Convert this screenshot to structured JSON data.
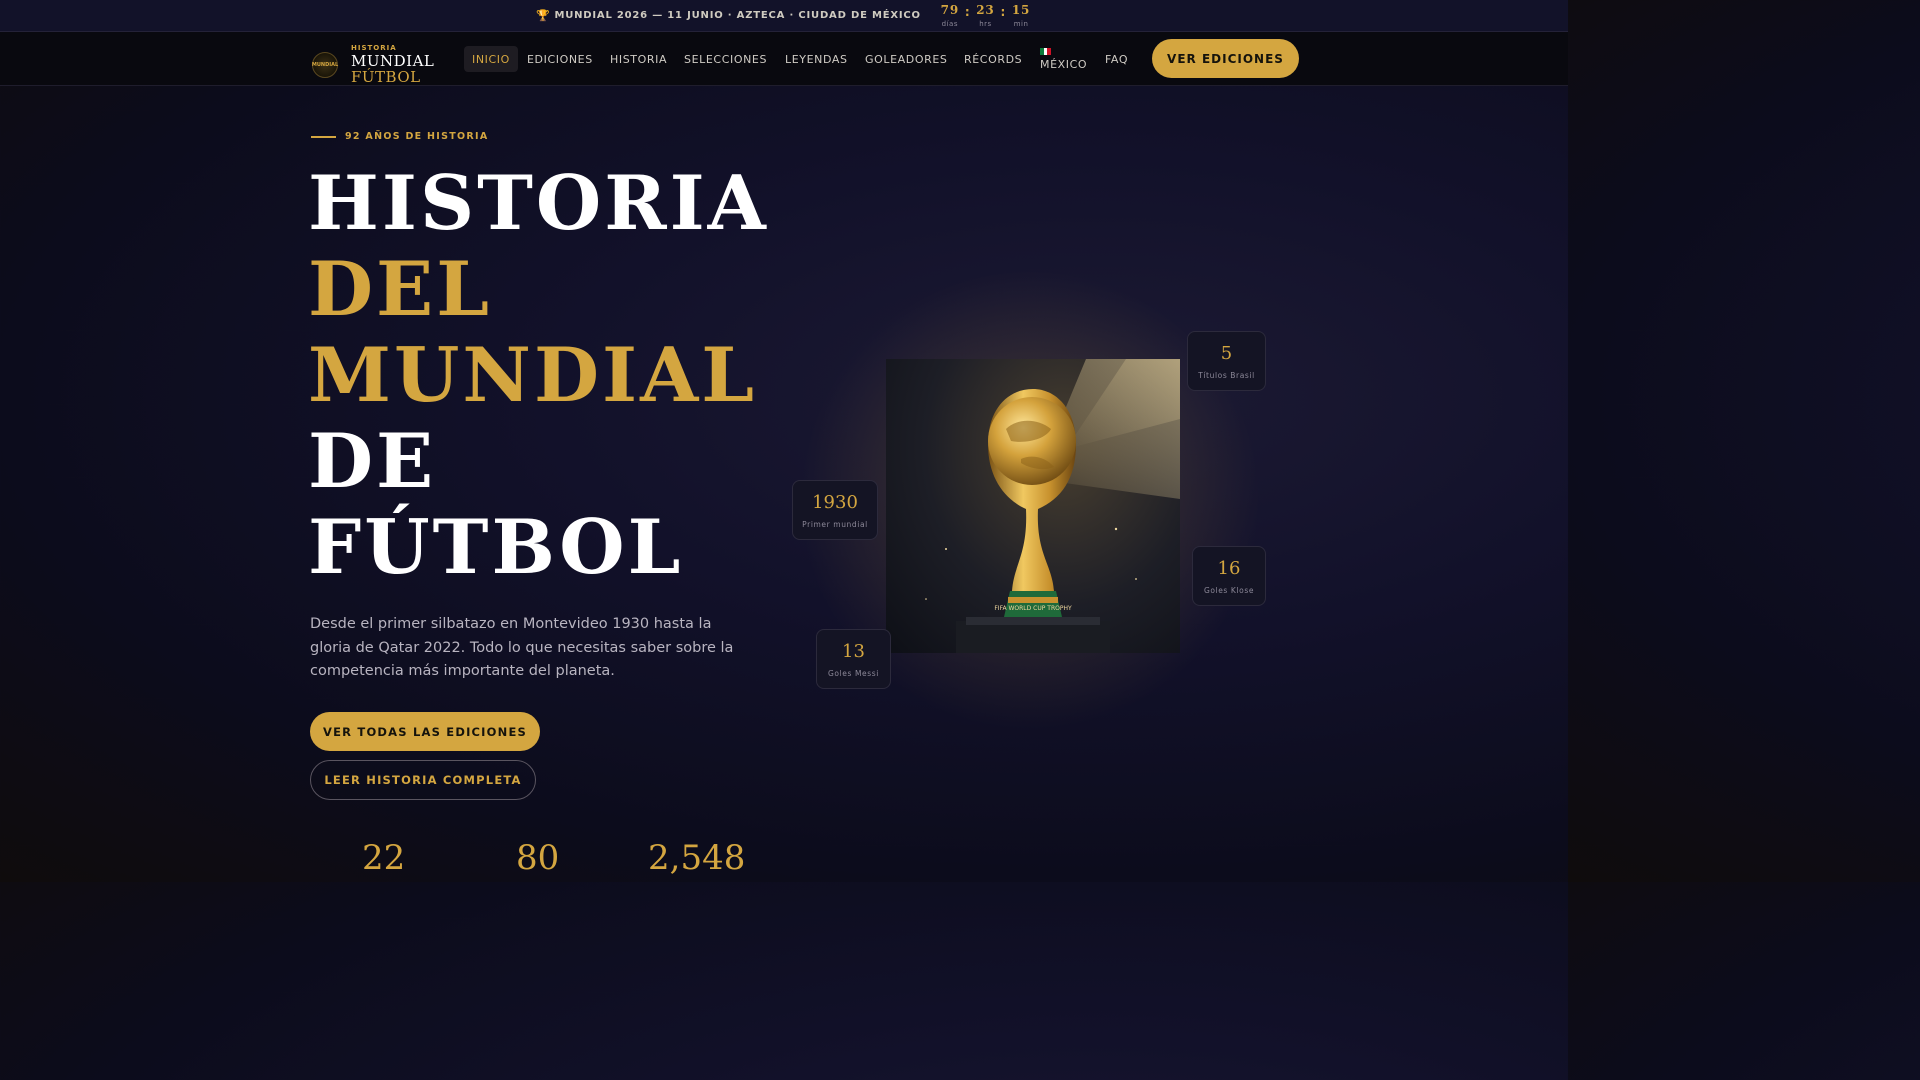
{
  "topbar": {
    "trophy_icon": "🏆",
    "announcement": "MUNDIAL 2026 — 11 JUNIO · AZTECA · CIUDAD DE MÉXICO",
    "countdown": [
      {
        "value": "79",
        "unit": "días"
      },
      {
        "value": "23",
        "unit": "hrs"
      },
      {
        "value": "15",
        "unit": "min"
      }
    ],
    "separator": ":"
  },
  "nav": {
    "logo_badge": "MUNDIAL",
    "logo_small": "HISTORIA",
    "logo_line1": "MUNDIAL",
    "logo_line2": "FÚTBOL",
    "items": [
      "INICIO",
      "EDICIONES",
      "HISTORIA",
      "SELECCIONES",
      "LEYENDAS",
      "GOLEADORES",
      "RÉCORDS"
    ],
    "mexico": "MÉXICO",
    "faq": "FAQ",
    "cta": "VER EDICIONES"
  },
  "hero": {
    "eyebrow": "92 AÑOS DE HISTORIA",
    "title": {
      "line1": "HISTORIA",
      "line2": "DEL",
      "line3": "MUNDIAL",
      "line4": "DE",
      "line5": "FÚTBOL"
    },
    "description": "Desde el primer silbatazo en Montevideo 1930 hasta la gloria de Qatar 2022. Todo lo que necesitas saber sobre la competencia más importante del planeta.",
    "primary_button": "VER TODAS LAS EDICIONES",
    "secondary_button": "LEER HISTORIA COMPLETA",
    "stats": [
      "22",
      "80",
      "2,548"
    ]
  },
  "cards": [
    {
      "value": "5",
      "label": "Títulos Brasil"
    },
    {
      "value": "1930",
      "label": "Primer mundial"
    },
    {
      "value": "16",
      "label": "Goles Klose"
    },
    {
      "value": "13",
      "label": "Goles Messi"
    }
  ],
  "trophy_image": {
    "plaque_text": "FIFA WORLD CUP TROPHY"
  },
  "colors": {
    "accent": "#d4a640",
    "background": "#12112a",
    "flag": [
      "#0a7a3a",
      "#ffffff",
      "#ce1126"
    ]
  }
}
